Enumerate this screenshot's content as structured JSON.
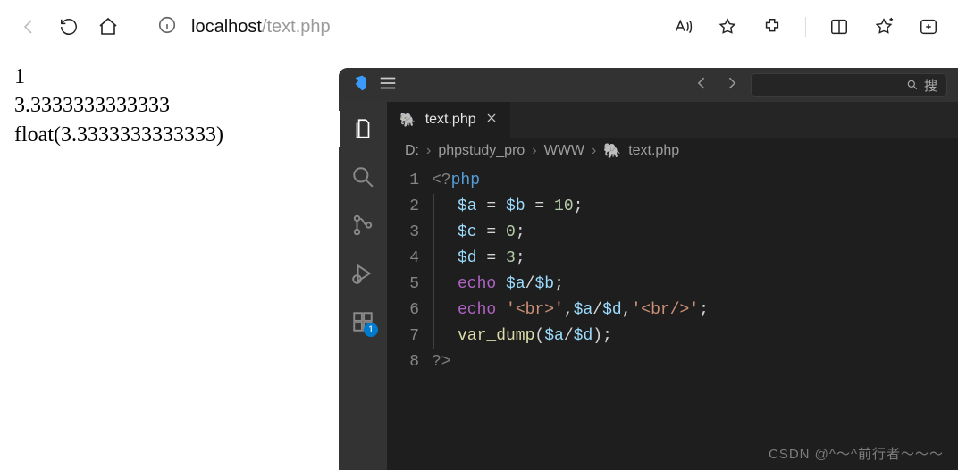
{
  "browser": {
    "url_host": "localhost",
    "url_path": "/text.php",
    "search_placeholder": "搜"
  },
  "page_output": {
    "line1": "1",
    "line2": "3.3333333333333",
    "line3": "float(3.3333333333333)"
  },
  "vscode": {
    "activity_badge": "1",
    "tab": {
      "label": "text.php"
    },
    "breadcrumb": {
      "drive": "D:",
      "seg1": "phpstudy_pro",
      "seg2": "WWW",
      "file": "text.php"
    },
    "code": {
      "l1": {
        "open": "<?",
        "kw": "php"
      },
      "l2": {
        "v1": "$a",
        "eq1": " = ",
        "v2": "$b",
        "eq2": " = ",
        "n": "10",
        "semi": ";"
      },
      "l3": {
        "v1": "$c",
        "eq": " = ",
        "n": "0",
        "semi": ";"
      },
      "l4": {
        "v1": "$d",
        "eq": " = ",
        "n": "3",
        "semi": ";"
      },
      "l5": {
        "kw": "echo",
        "sp": " ",
        "v1": "$a",
        "op": "/",
        "v2": "$b",
        "semi": ";"
      },
      "l6": {
        "kw": "echo",
        "sp": " ",
        "s1": "'<br>'",
        "c1": ",",
        "v1": "$a",
        "op": "/",
        "v2": "$d",
        "c2": ",",
        "s2": "'<br/>'",
        "semi": ";"
      },
      "l7": {
        "fn": "var_dump",
        "lp": "(",
        "v1": "$a",
        "op": "/",
        "v2": "$d",
        "rp": ")",
        "semi": ";"
      },
      "l8": {
        "close": "?>"
      }
    },
    "line_numbers": [
      "1",
      "2",
      "3",
      "4",
      "5",
      "6",
      "7",
      "8"
    ]
  },
  "watermark": "CSDN @^～^前行者～～～"
}
